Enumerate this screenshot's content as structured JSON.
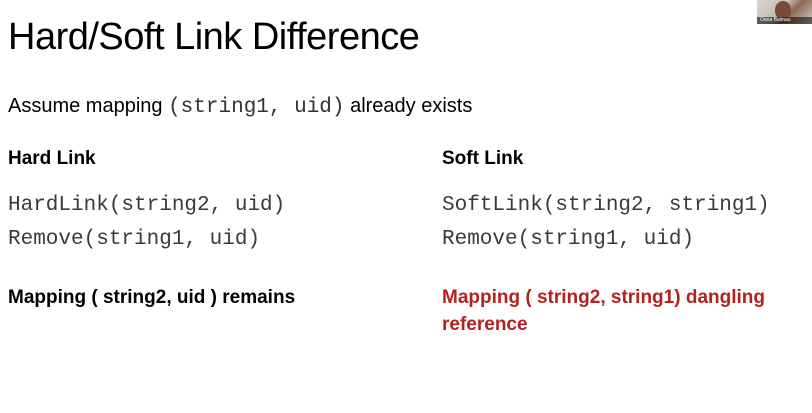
{
  "slide": {
    "title": "Hard/Soft Link Difference",
    "assume": {
      "prefix": "Assume mapping ",
      "code": "(string1, uid)",
      "suffix": " already exists"
    },
    "hard": {
      "heading": "Hard Link",
      "line1": "HardLink(string2, uid)",
      "line2": "Remove(string1, uid)",
      "result": "Mapping ( string2, uid ) remains"
    },
    "soft": {
      "heading": "Soft Link",
      "line1": "SoftLink(string2, string1)",
      "line2": "Remove(string1, uid)",
      "result": "Mapping ( string2, string1) dangling reference"
    }
  },
  "webcam": {
    "name": "Oana Balmau"
  },
  "colors": {
    "text": "#000000",
    "code": "#3a3a3a",
    "accent_red": "#b5211f"
  }
}
